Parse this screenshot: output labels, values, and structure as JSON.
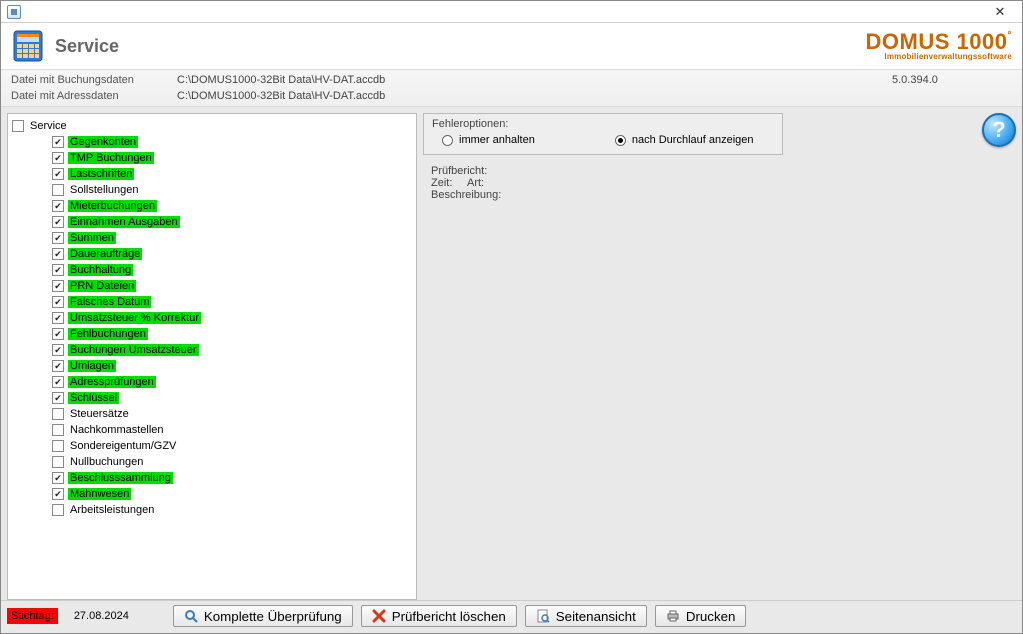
{
  "window": {
    "title": ""
  },
  "header": {
    "title": "Service",
    "brand_main": "DOMUS 1000",
    "brand_sub": "Immobilienverwaltungssoftware"
  },
  "meta": {
    "label_buchungsdaten": "Datei mit Buchungsdaten",
    "value_buchungsdaten": "C:\\DOMUS1000-32Bit Data\\HV-DAT.accdb",
    "label_adressdaten": "Datei mit Adressdaten",
    "value_adressdaten": "C:\\DOMUS1000-32Bit Data\\HV-DAT.accdb",
    "version": "5.0.394.0"
  },
  "tree": {
    "root_label": "Service",
    "root_checked": false,
    "items": [
      {
        "label": "Gegenkonten",
        "checked": true,
        "hi": true
      },
      {
        "label": "TMP Buchungen",
        "checked": true,
        "hi": true
      },
      {
        "label": "Lastschriften",
        "checked": true,
        "hi": true
      },
      {
        "label": "Sollstellungen",
        "checked": false,
        "hi": false
      },
      {
        "label": "Mieterbuchungen",
        "checked": true,
        "hi": true
      },
      {
        "label": "Einnahmen Ausgaben",
        "checked": true,
        "hi": true
      },
      {
        "label": "Summen",
        "checked": true,
        "hi": true
      },
      {
        "label": "Daueraufträge",
        "checked": true,
        "hi": true
      },
      {
        "label": "Buchhaltung",
        "checked": true,
        "hi": true
      },
      {
        "label": "PRN Dateien",
        "checked": true,
        "hi": true
      },
      {
        "label": "Falsches Datum",
        "checked": true,
        "hi": true
      },
      {
        "label": "Umsatzsteuer % Korrektur",
        "checked": true,
        "hi": true
      },
      {
        "label": "Fehlbuchungen",
        "checked": true,
        "hi": true
      },
      {
        "label": "Buchungen Umsatzsteuer",
        "checked": true,
        "hi": true
      },
      {
        "label": "Umlagen",
        "checked": true,
        "hi": true
      },
      {
        "label": "Adressprüfungen",
        "checked": true,
        "hi": true
      },
      {
        "label": "Schlüssel",
        "checked": true,
        "hi": true
      },
      {
        "label": "Steuersätze",
        "checked": false,
        "hi": false
      },
      {
        "label": "Nachkommastellen",
        "checked": false,
        "hi": false
      },
      {
        "label": "Sondereigentum/GZV",
        "checked": false,
        "hi": false
      },
      {
        "label": "Nullbuchungen",
        "checked": false,
        "hi": false
      },
      {
        "label": "Beschlusssammlung",
        "checked": true,
        "hi": true
      },
      {
        "label": "Mahnwesen",
        "checked": true,
        "hi": true
      },
      {
        "label": "Arbeitsleistungen",
        "checked": false,
        "hi": false
      }
    ]
  },
  "error_opts": {
    "group_title": "Fehleroptionen:",
    "opt_always": "immer anhalten",
    "opt_after": "nach Durchlauf anzeigen",
    "selected": "after"
  },
  "report": {
    "title": "Prüfbericht:",
    "zeit_lbl": "Zeit:",
    "art_lbl": "Art:",
    "besch_lbl": "Beschreibung:"
  },
  "bottom": {
    "stichtag_lbl": "Stichtag:",
    "stichtag_val": "27.08.2024",
    "btn_full": "Komplette Überprüfung",
    "btn_clear": "Prüfbericht löschen",
    "btn_preview": "Seitenansicht",
    "btn_print": "Drucken"
  }
}
